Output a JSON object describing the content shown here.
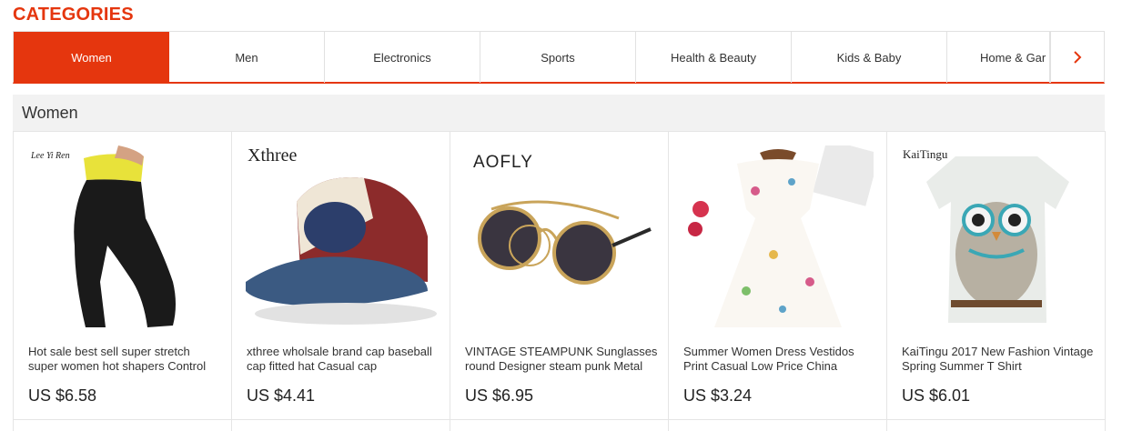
{
  "header": {
    "title": "CATEGORIES"
  },
  "tabs": [
    {
      "label": "Women"
    },
    {
      "label": "Men"
    },
    {
      "label": "Electronics"
    },
    {
      "label": "Sports"
    },
    {
      "label": "Health & Beauty"
    },
    {
      "label": "Kids & Baby"
    },
    {
      "label": "Home & Gar"
    }
  ],
  "section": {
    "title": "Women"
  },
  "products": [
    {
      "brand": "Lee Yi Ren",
      "name": "Hot sale best sell super stretch super women hot shapers Control",
      "price": "US $6.58"
    },
    {
      "brand": "Xthree",
      "name": "xthree wholsale brand cap baseball cap fitted hat Casual cap",
      "price": "US $4.41"
    },
    {
      "brand": "AOFLY",
      "name": "VINTAGE STEAMPUNK Sunglasses round Designer steam punk Metal",
      "price": "US $6.95"
    },
    {
      "brand": "",
      "name": "Summer Women Dress Vestidos Print Casual Low Price China",
      "price": "US $3.24"
    },
    {
      "brand": "KaiTingu",
      "name": "KaiTingu 2017 New Fashion Vintage Spring Summer T Shirt",
      "price": "US $6.01"
    }
  ],
  "colors": {
    "accent": "#e5360e",
    "tab_border": "#e1e1e1",
    "section_bg": "#f2f2f2"
  },
  "icons": {
    "next": "chevron-right-icon"
  }
}
